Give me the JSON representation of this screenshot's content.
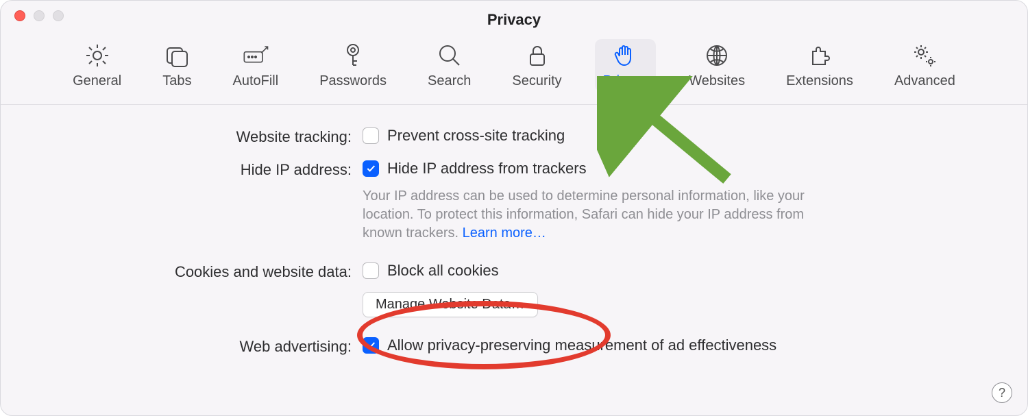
{
  "window": {
    "title": "Privacy"
  },
  "toolbar": {
    "items": [
      {
        "label": "General",
        "icon": "gear-icon"
      },
      {
        "label": "Tabs",
        "icon": "tabs-icon"
      },
      {
        "label": "AutoFill",
        "icon": "autofill-icon"
      },
      {
        "label": "Passwords",
        "icon": "key-icon"
      },
      {
        "label": "Search",
        "icon": "search-icon"
      },
      {
        "label": "Security",
        "icon": "lock-icon"
      },
      {
        "label": "Privacy",
        "icon": "hand-icon"
      },
      {
        "label": "Websites",
        "icon": "globe-icon"
      },
      {
        "label": "Extensions",
        "icon": "puzzle-icon"
      },
      {
        "label": "Advanced",
        "icon": "gears-icon"
      }
    ],
    "active_index": 6
  },
  "content": {
    "tracking": {
      "label": "Website tracking:",
      "prevent_label": "Prevent cross-site tracking",
      "prevent_checked": false
    },
    "hide_ip": {
      "label": "Hide IP address:",
      "checkbox_label": "Hide IP address from trackers",
      "checked": true,
      "hint": "Your IP address can be used to determine personal information, like your location. To protect this information, Safari can hide your IP address from known trackers. ",
      "learn_more": "Learn more…"
    },
    "cookies": {
      "label": "Cookies and website data:",
      "block_label": "Block all cookies",
      "block_checked": false,
      "manage_button": "Manage Website Data…"
    },
    "ads": {
      "label": "Web advertising:",
      "allow_label": "Allow privacy-preserving measurement of ad effectiveness",
      "checked": true
    }
  },
  "help_button": "?",
  "annotations": {
    "arrow_color": "#6aa63c",
    "circle_color": "#e23b2e"
  }
}
